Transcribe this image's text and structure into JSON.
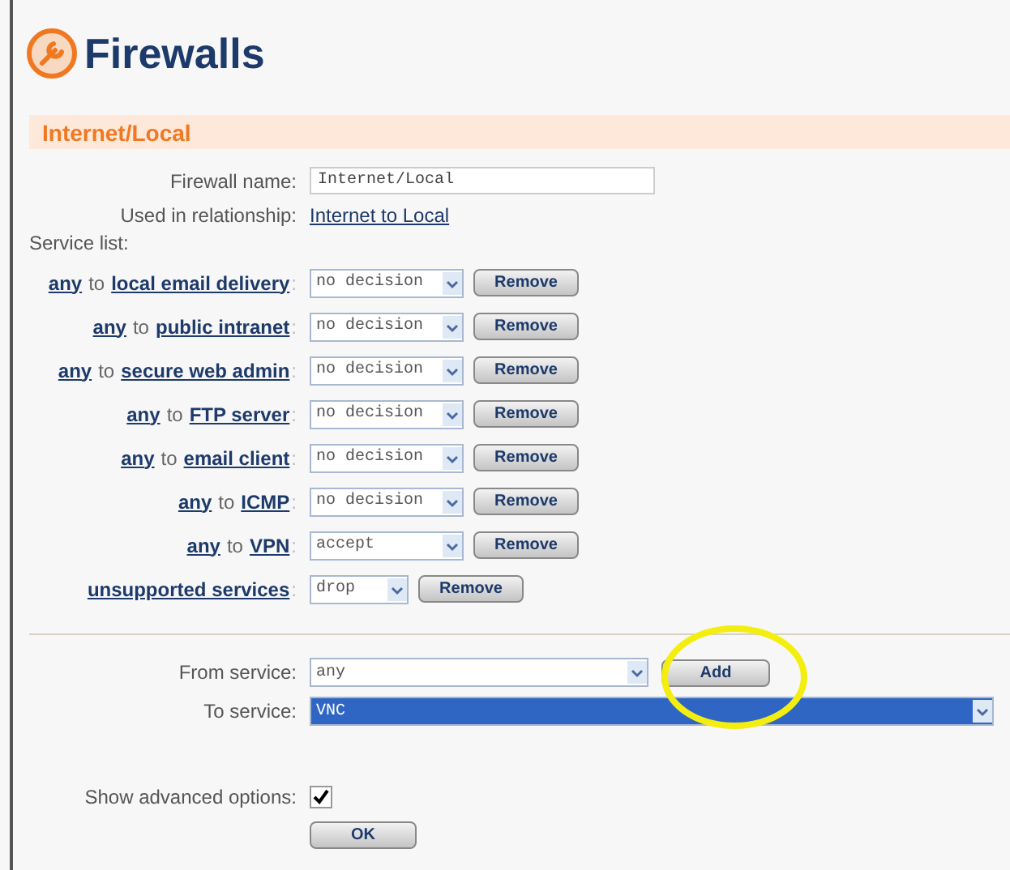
{
  "header": {
    "title": "Firewalls"
  },
  "section": {
    "title": "Internet/Local"
  },
  "firewall_name": {
    "label": "Firewall name:",
    "value": "Internet/Local"
  },
  "relationship": {
    "label": "Used in relationship:",
    "link": "Internet to Local"
  },
  "service_list": {
    "label": "Service list:",
    "rules": [
      {
        "kind": "rule",
        "from": "any",
        "joiner": "to",
        "to": "local email delivery",
        "colon": ":",
        "action": "no decision",
        "button": "Remove"
      },
      {
        "kind": "rule",
        "from": "any",
        "joiner": "to",
        "to": "public intranet",
        "colon": ":",
        "action": "no decision",
        "button": "Remove"
      },
      {
        "kind": "rule",
        "from": "any",
        "joiner": "to",
        "to": "secure web admin",
        "colon": ":",
        "action": "no decision",
        "button": "Remove"
      },
      {
        "kind": "rule",
        "from": "any",
        "joiner": "to",
        "to": "FTP server",
        "colon": ":",
        "action": "no decision",
        "button": "Remove"
      },
      {
        "kind": "rule",
        "from": "any",
        "joiner": "to",
        "to": "email client",
        "colon": ":",
        "action": "no decision",
        "button": "Remove"
      },
      {
        "kind": "rule",
        "from": "any",
        "joiner": "to",
        "to": "ICMP",
        "colon": ":",
        "action": "no decision",
        "button": "Remove"
      },
      {
        "kind": "rule",
        "from": "any",
        "joiner": "to",
        "to": "VPN",
        "colon": ":",
        "action": "accept",
        "button": "Remove"
      },
      {
        "kind": "unsupported",
        "name": "unsupported services",
        "colon": ":",
        "action": "drop",
        "button": "Remove"
      }
    ]
  },
  "from_service": {
    "label": "From service:",
    "value": "any",
    "button": "Add"
  },
  "to_service": {
    "label": "To service:",
    "value": "VNC",
    "selected": true
  },
  "advanced": {
    "label": "Show advanced options:",
    "checked": true
  },
  "ok_button": "OK"
}
